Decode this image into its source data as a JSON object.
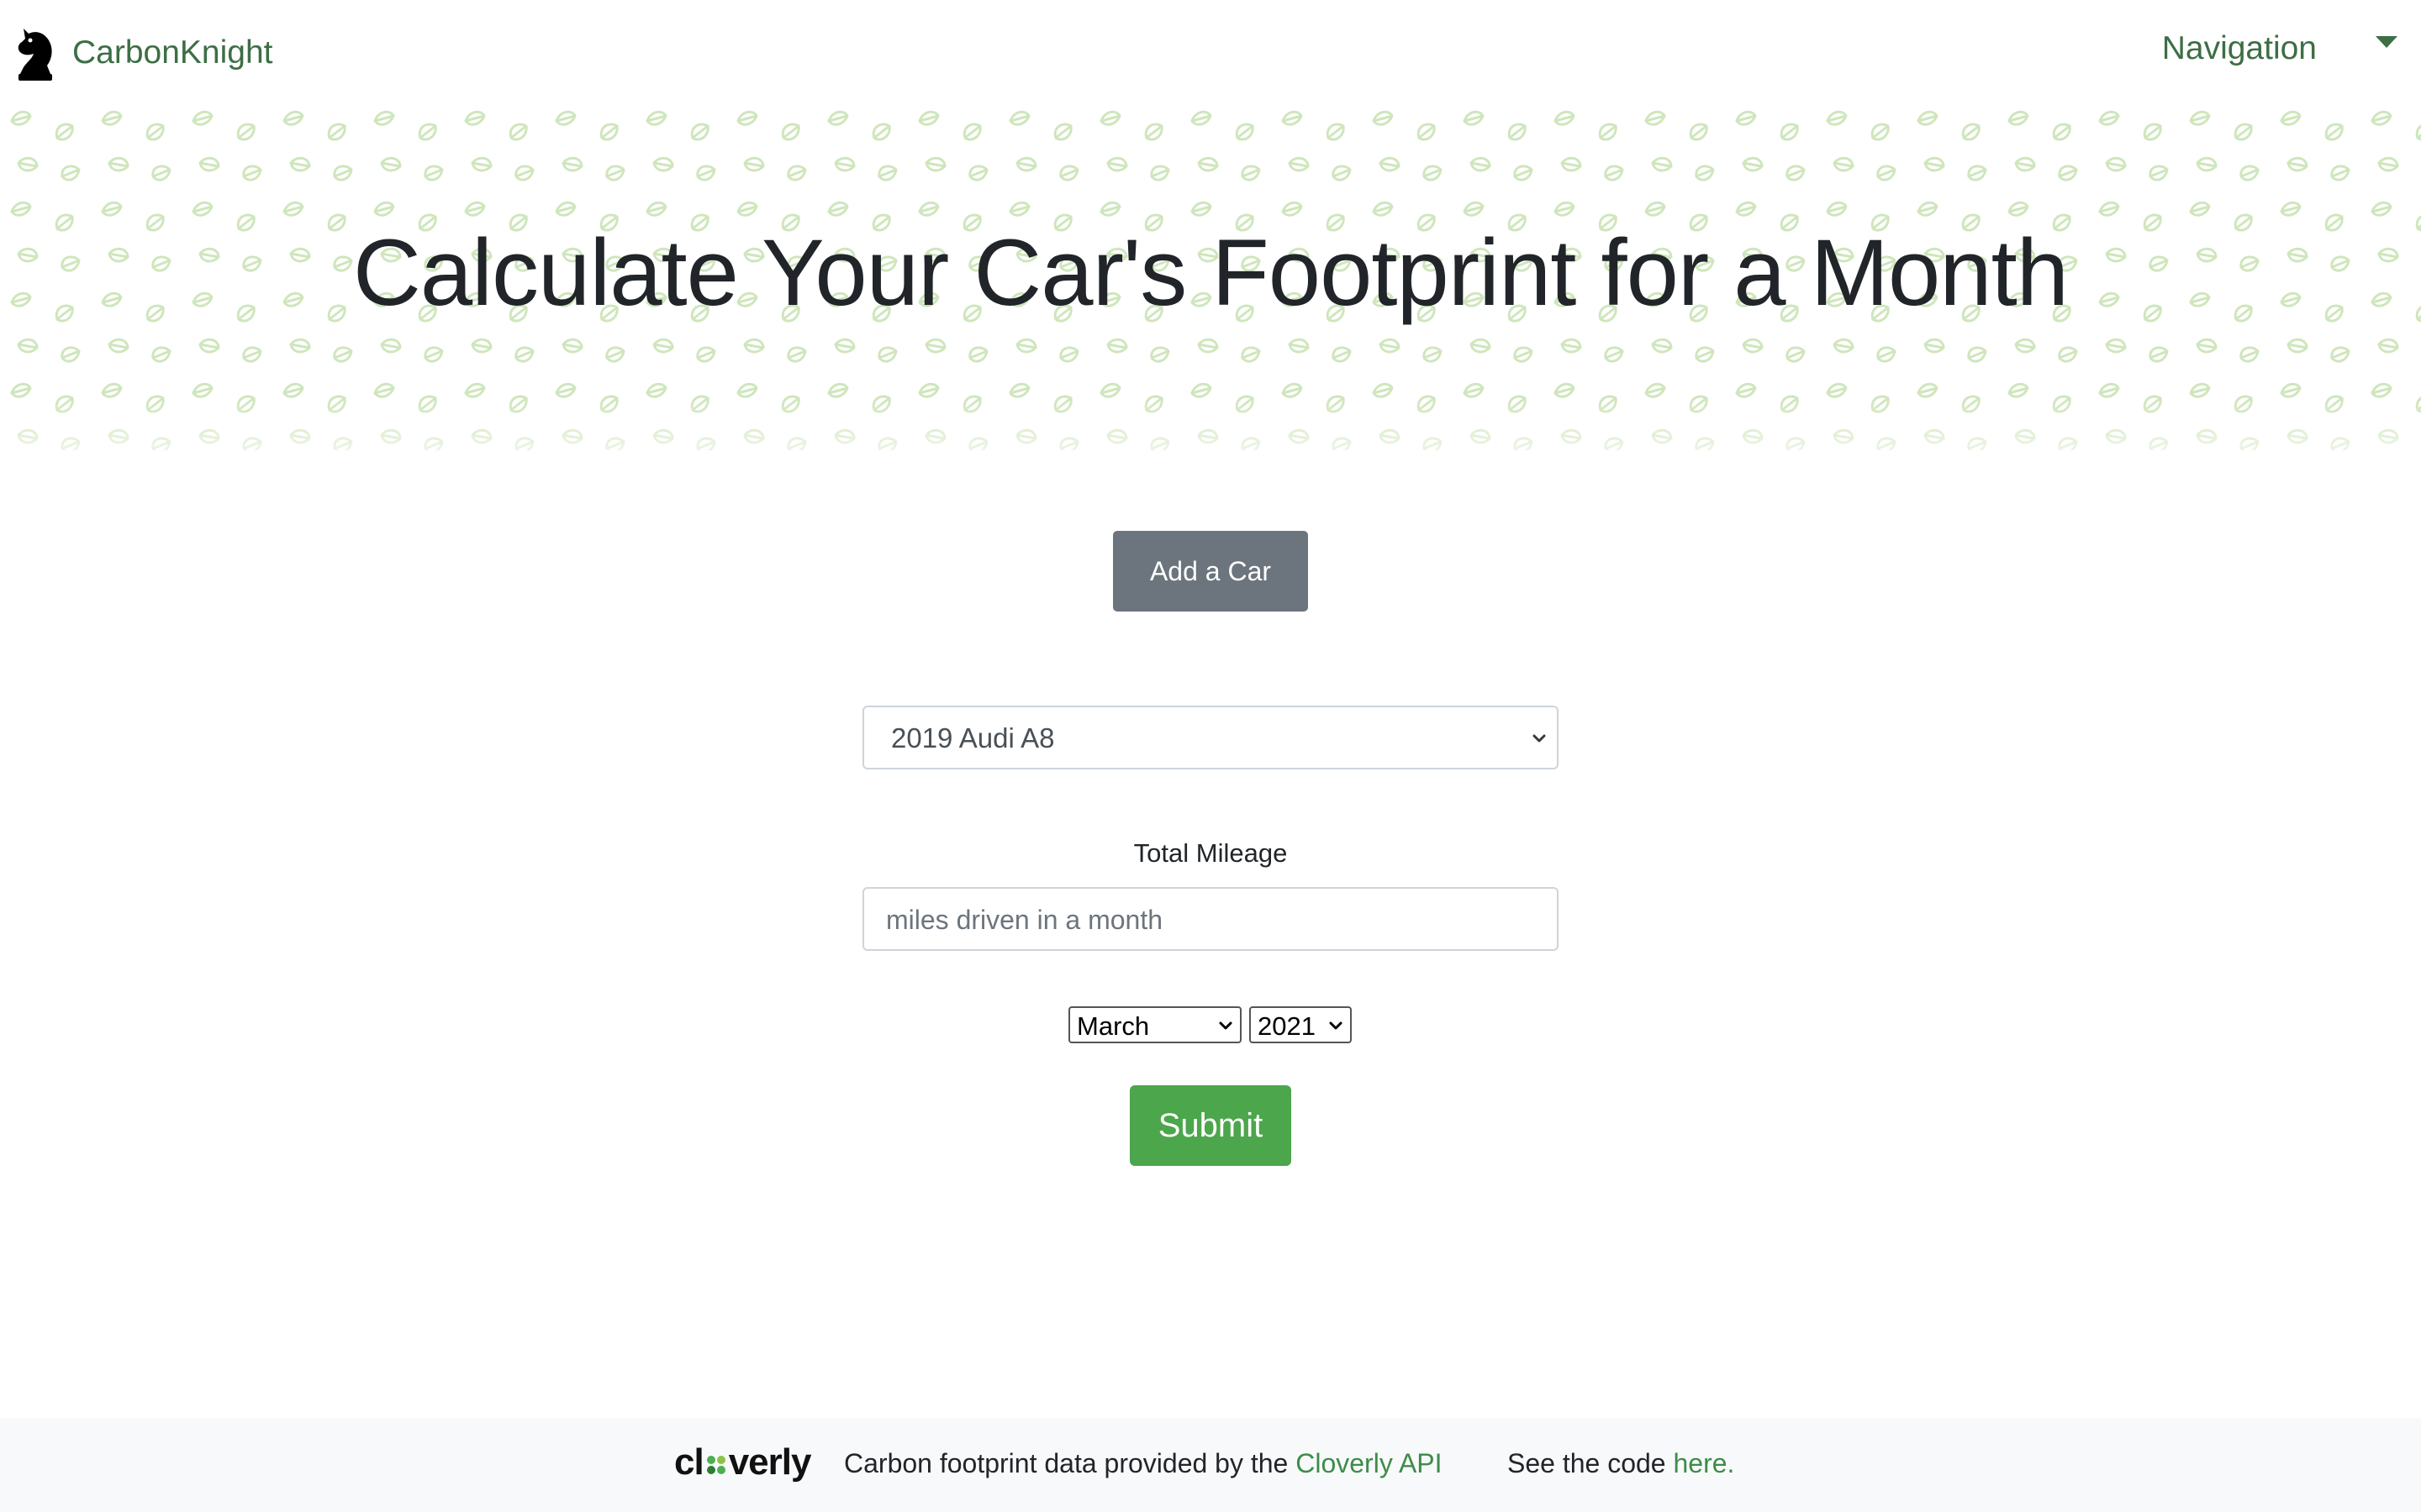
{
  "navbar": {
    "brand": "CarbonKnight",
    "nav_label": "Navigation"
  },
  "hero": {
    "title": "Calculate Your Car's Footprint for a Month"
  },
  "form": {
    "add_car_label": "Add a Car",
    "car_selected": "2019 Audi A8",
    "mileage_label": "Total Mileage",
    "mileage_placeholder": "miles driven in a month",
    "month_selected": "March",
    "year_selected": "2021",
    "submit_label": "Submit"
  },
  "footer": {
    "logo_text_a": "cl",
    "logo_text_b": "verly",
    "data_text": "Carbon footprint data provided by the ",
    "api_link": "Cloverly API",
    "code_text": "See the code ",
    "code_link": "here."
  },
  "colors": {
    "brand_green": "#3d6e45",
    "submit_green": "#4ca64c",
    "secondary_gray": "#6c757d",
    "leaf_pattern": "#cde5b8"
  },
  "icons": [
    "knight-chess-icon",
    "chevron-down-icon",
    "clover-icon"
  ]
}
